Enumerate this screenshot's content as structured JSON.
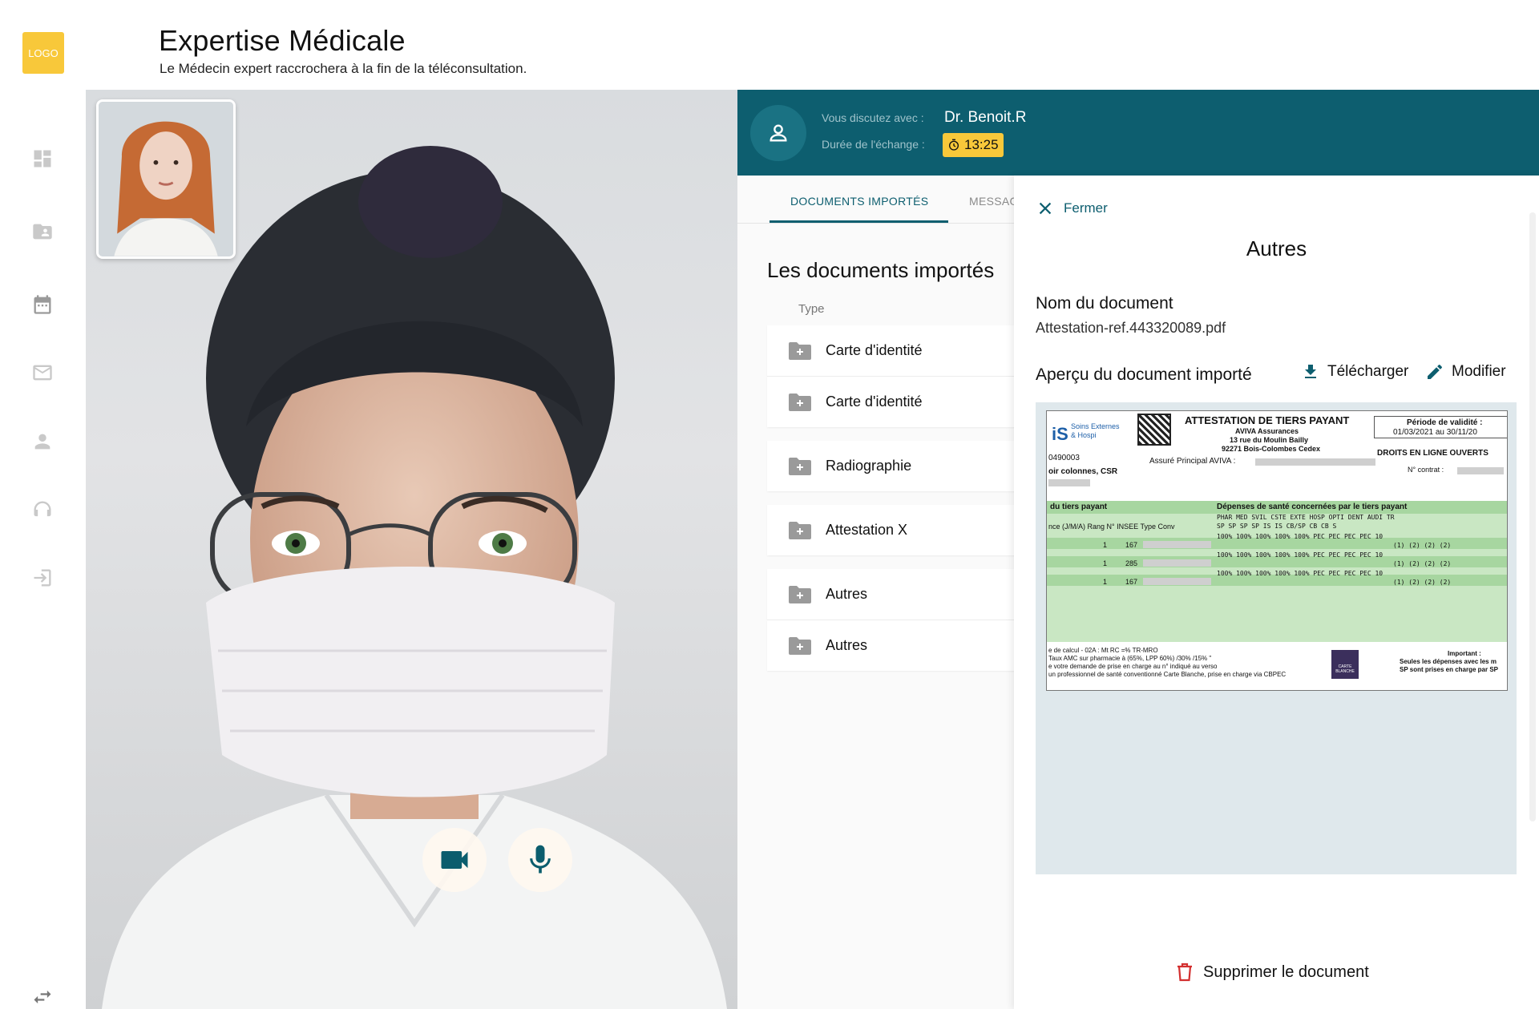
{
  "app": {
    "logo_text": "LOGO"
  },
  "header": {
    "title": "Expertise Médicale",
    "subtitle": "Le Médecin expert raccrochera à la fin de la téléconsultation."
  },
  "sidebar": {
    "icons": [
      "dashboard-icon",
      "folder-user-icon",
      "calendar-icon",
      "mail-icon",
      "user-icon",
      "support-icon",
      "logout-icon",
      "collapse-icon"
    ]
  },
  "chat": {
    "talking_label": "Vous discutez avec :",
    "doctor_name": "Dr. Benoit.R",
    "duration_label": "Durée de l'échange :",
    "duration_value": "13:25"
  },
  "tabs": [
    {
      "label": "Documents importés",
      "active": true
    },
    {
      "label": "Messag",
      "active": false
    }
  ],
  "documents": {
    "title": "Les documents importés",
    "column_type": "Type",
    "items": [
      {
        "label": "Carte d'identité"
      },
      {
        "label": "Carte d'identité"
      },
      {
        "label": "Radiographie"
      },
      {
        "label": "Attestation X"
      },
      {
        "label": "Autres"
      },
      {
        "label": "Autres"
      }
    ]
  },
  "drawer": {
    "close_label": "Fermer",
    "title": "Autres",
    "doc_name_label": "Nom du document",
    "doc_name_value": "Attestation-ref.443320089.pdf",
    "preview_label": "Aperçu du document importé",
    "download_label": "Télécharger",
    "edit_label": "Modifier",
    "delete_label": "Supprimer le document"
  },
  "attestation": {
    "title": "ATTESTATION DE TIERS PAYANT",
    "insurer": "AVIVA Assurances",
    "address1": "13 rue du Moulin Bailly",
    "address2": "92271 Bois-Colombes Cedex",
    "validity_label": "Période de validité :",
    "validity_value": "01/03/2021 au 30/11/20",
    "rights": "DROITS EN LIGNE OUVERTS",
    "contract_label": "N° contrat :",
    "insured": "Assuré Principal AVIVA :",
    "brand_line1": "Soins Externes",
    "brand_line2": "& Hospi",
    "ref_number": "0490003",
    "columns_note": "oir colonnes, CSR",
    "section_left": "du tiers payant",
    "section_right": "Dépenses de santé concernées par le tiers payant",
    "col_headers": "nce (J/M/A)  Rang  N° INSEE       Type Conv",
    "codes": "PHAR   MED   SVIL  CSTE  EXTE  HOSP  OPTI  DENT  AUDI  TR",
    "codes_sub": "SP      SP     SP     SP     IS     IS    CB/SP   CB     CB     S",
    "row_values": "100%     100%  100%  100%  100%   PEC    PEC    PEC    PEC   10",
    "row_sub": "(1)     (2)     (2)     (2)",
    "rows": [
      {
        "rang": "1",
        "insee": "167"
      },
      {
        "rang": "1",
        "insee": "285"
      },
      {
        "rang": "1",
        "insee": "167"
      }
    ],
    "footer1": "e de calcul - 02A : Mt RC =% TR-MRO",
    "footer2": "Taux AMC sur pharmacie à (65%, LPP 60%) /30% /15% \"",
    "footer3": "e votre demande de prise en charge au n° indiqué au verso",
    "footer4": "un professionnel de santé conventionné Carte Blanche, prise en charge via CBPEC",
    "important_label": "Important :",
    "important1": "Seules les dépenses avec les m",
    "important2": "SP sont prises en charge par SP",
    "carte_blanche_1": "CARTE",
    "carte_blanche_2": "BLANCHE"
  },
  "colors": {
    "teal": "#0d5e6f",
    "yellow": "#f8c83a",
    "danger": "#d32f2f"
  }
}
